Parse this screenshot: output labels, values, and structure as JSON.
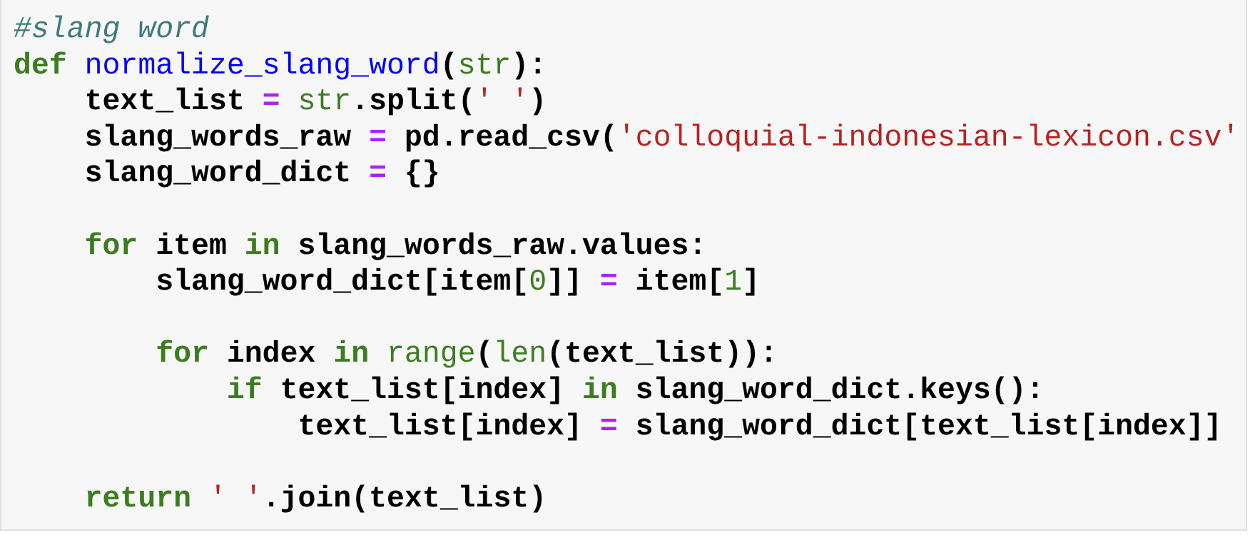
{
  "colors": {
    "background": "#f7f7f7",
    "comment": "#3d7b7b",
    "keyword": "#3b7d1f",
    "function_name": "#0000ff",
    "operator": "#aa22ff",
    "string": "#ba2121"
  },
  "code_lines": [
    [
      [
        "comment",
        "#slang word"
      ]
    ],
    [
      [
        "kw",
        "def"
      ],
      [
        "plain",
        " "
      ],
      [
        "fn",
        "normalize_slang_word"
      ],
      [
        "plain",
        "("
      ],
      [
        "builtin",
        "str"
      ],
      [
        "plain",
        "):"
      ]
    ],
    [
      [
        "plain",
        "    text_list "
      ],
      [
        "op",
        "="
      ],
      [
        "plain",
        " "
      ],
      [
        "builtin",
        "str"
      ],
      [
        "plain",
        ".split("
      ],
      [
        "str",
        "' '"
      ],
      [
        "plain",
        ")"
      ]
    ],
    [
      [
        "plain",
        "    slang_words_raw "
      ],
      [
        "op",
        "="
      ],
      [
        "plain",
        " pd.read_csv("
      ],
      [
        "str",
        "'colloquial-indonesian-lexicon.csv'"
      ]
    ],
    [
      [
        "plain",
        "    slang_word_dict "
      ],
      [
        "op",
        "="
      ],
      [
        "plain",
        " {}"
      ]
    ],
    [
      [
        "plain",
        ""
      ]
    ],
    [
      [
        "plain",
        "    "
      ],
      [
        "kw",
        "for"
      ],
      [
        "plain",
        " item "
      ],
      [
        "kw",
        "in"
      ],
      [
        "plain",
        " slang_words_raw.values:"
      ]
    ],
    [
      [
        "plain",
        "        slang_word_dict[item["
      ],
      [
        "num",
        "0"
      ],
      [
        "plain",
        "]] "
      ],
      [
        "op",
        "="
      ],
      [
        "plain",
        " item["
      ],
      [
        "num",
        "1"
      ],
      [
        "plain",
        "]"
      ]
    ],
    [
      [
        "plain",
        ""
      ]
    ],
    [
      [
        "plain",
        "        "
      ],
      [
        "kw",
        "for"
      ],
      [
        "plain",
        " index "
      ],
      [
        "kw",
        "in"
      ],
      [
        "plain",
        " "
      ],
      [
        "builtin",
        "range"
      ],
      [
        "plain",
        "("
      ],
      [
        "builtin",
        "len"
      ],
      [
        "plain",
        "(text_list)):"
      ]
    ],
    [
      [
        "plain",
        "            "
      ],
      [
        "kw",
        "if"
      ],
      [
        "plain",
        " text_list[index] "
      ],
      [
        "kw",
        "in"
      ],
      [
        "plain",
        " slang_word_dict.keys():"
      ]
    ],
    [
      [
        "plain",
        "                text_list[index] "
      ],
      [
        "op",
        "="
      ],
      [
        "plain",
        " slang_word_dict[text_list[index]]"
      ]
    ],
    [
      [
        "plain",
        ""
      ]
    ],
    [
      [
        "plain",
        "    "
      ],
      [
        "kw",
        "return"
      ],
      [
        "plain",
        " "
      ],
      [
        "str",
        "' '"
      ],
      [
        "plain",
        ".join(text_list)"
      ]
    ]
  ]
}
